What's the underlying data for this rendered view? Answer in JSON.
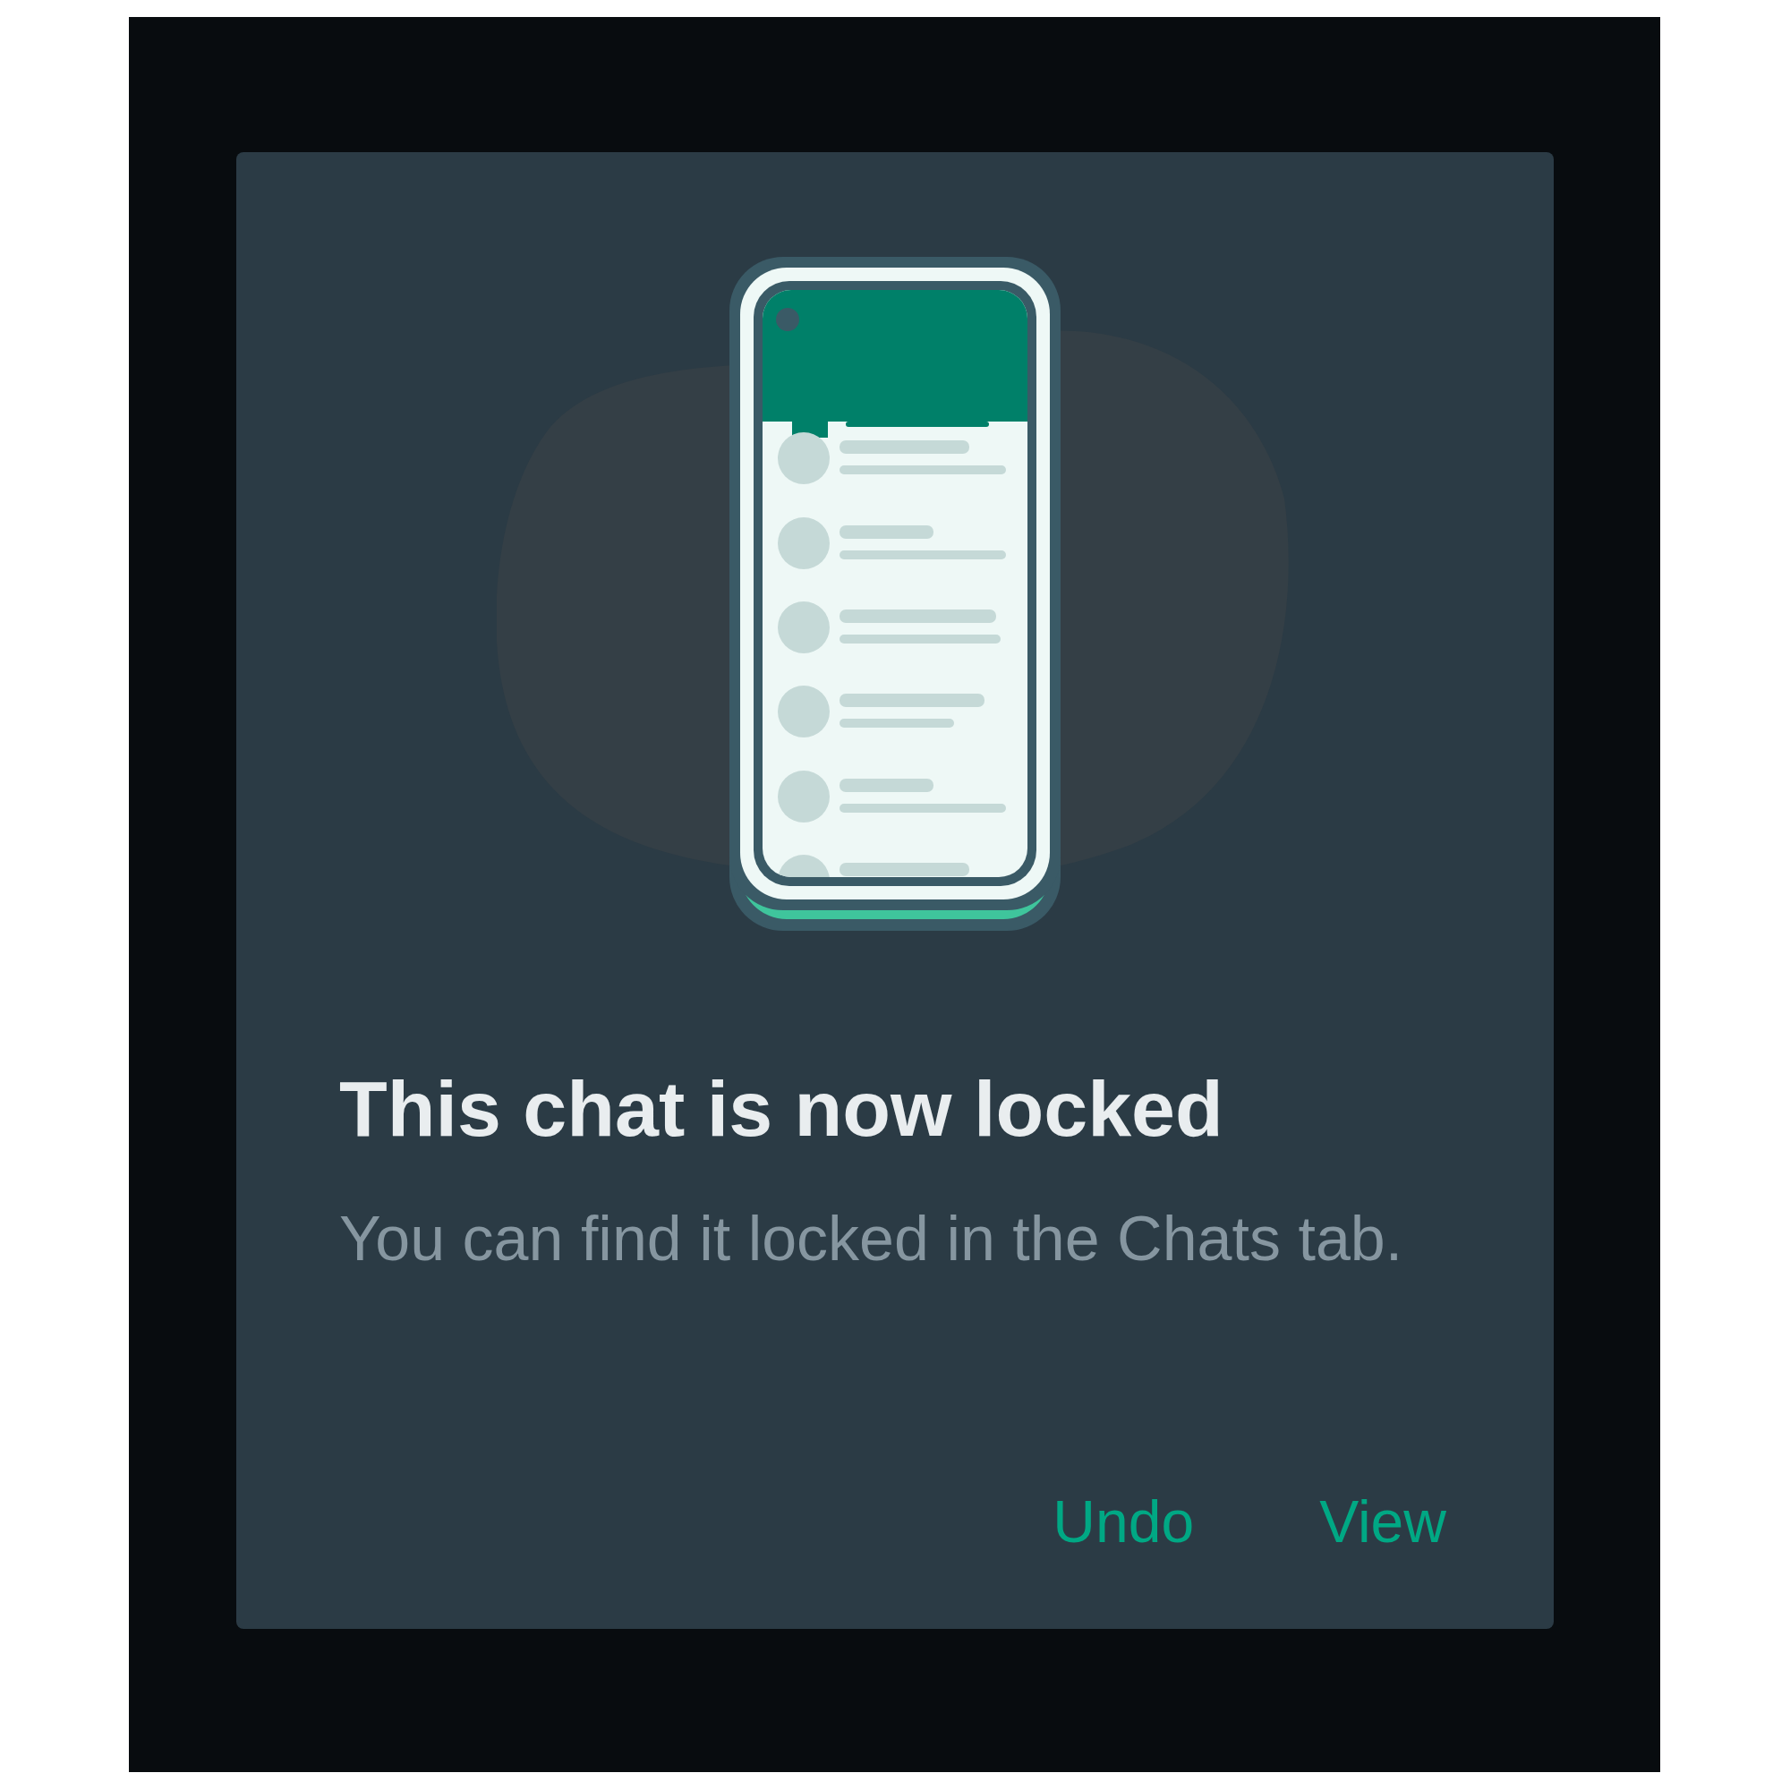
{
  "dialog": {
    "title": "This chat is now locked",
    "message": "You can find it locked in the Chats tab.",
    "buttons": [
      {
        "label": "Undo"
      },
      {
        "label": "View"
      }
    ]
  }
}
